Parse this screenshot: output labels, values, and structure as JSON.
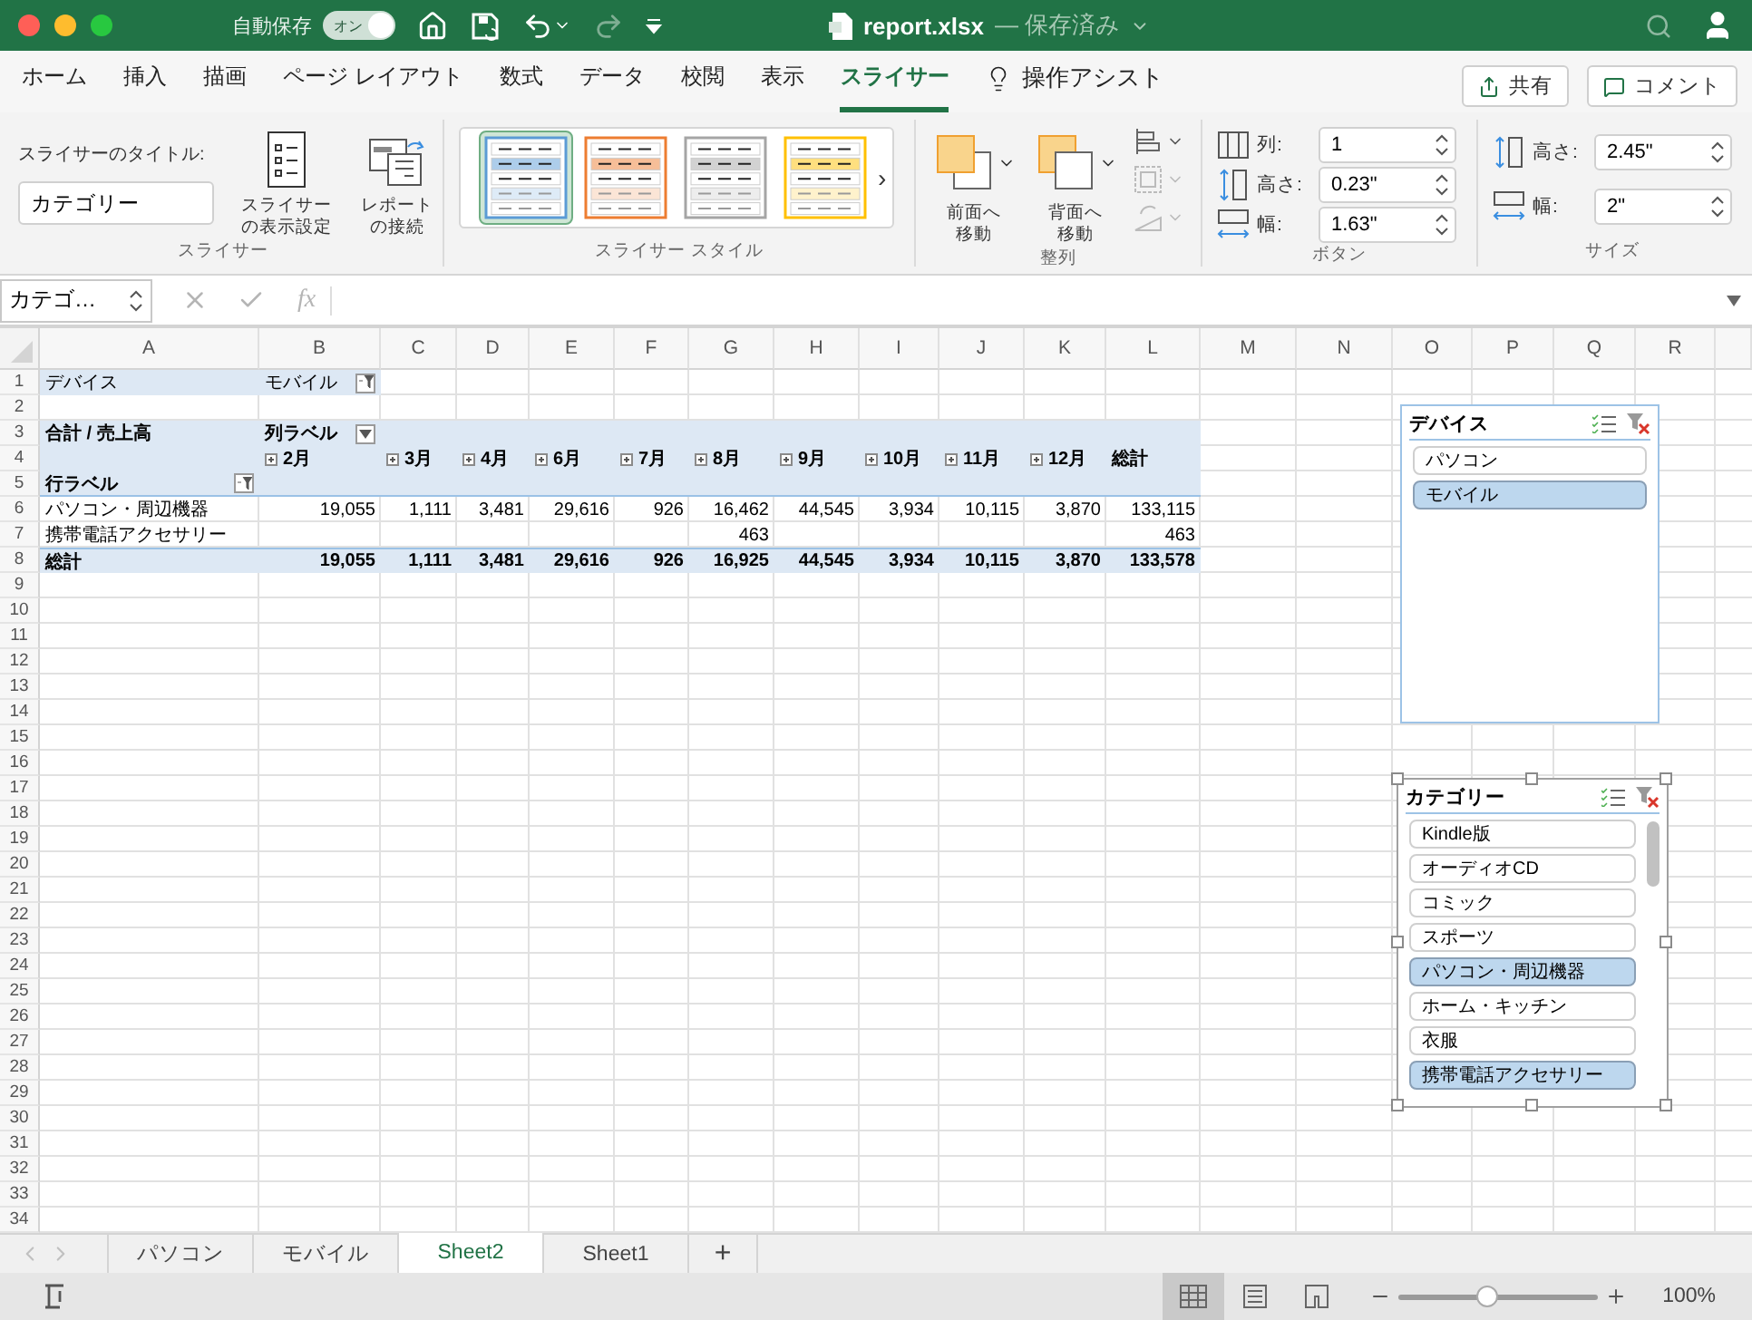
{
  "title_bar": {
    "autosave_label": "自動保存",
    "autosave": {
      "label": "オン",
      "on": true
    },
    "redo_disabled": true,
    "filename": "report.xlsx",
    "status": "— 保存済み"
  },
  "ribbon_tabs": [
    {
      "label": "ホーム",
      "selected": false
    },
    {
      "label": "挿入",
      "selected": false
    },
    {
      "label": "描画",
      "selected": false
    },
    {
      "label": "ページ レイアウト",
      "selected": false
    },
    {
      "label": "数式",
      "selected": false
    },
    {
      "label": "データ",
      "selected": false
    },
    {
      "label": "校閲",
      "selected": false
    },
    {
      "label": "表示",
      "selected": false
    },
    {
      "label": "スライサー",
      "selected": true
    }
  ],
  "tell_me": "操作アシスト",
  "share_button": "共有",
  "comment_button": "コメント",
  "ribbon": {
    "slicer_group": {
      "title_label": "スライサーのタイトル:",
      "title_value": "カテゴリー",
      "buttons": [
        {
          "kind": "settings",
          "lines": [
            "スライサー",
            "の表示設定"
          ]
        },
        {
          "kind": "connections",
          "lines": [
            "レポート",
            "の接続"
          ]
        }
      ],
      "label": "スライサー"
    },
    "styles_group": {
      "styles": [
        {
          "color": "#5b9bd5",
          "selected": true
        },
        {
          "color": "#ed7d31",
          "selected": false
        },
        {
          "color": "#a5a5a5",
          "selected": false
        },
        {
          "color": "#ffc000",
          "selected": false
        }
      ],
      "more": "›",
      "label": "スライサー スタイル"
    },
    "arrange_group": {
      "buttons": [
        {
          "kind": "front",
          "lines": [
            "前面へ",
            "移動"
          ]
        },
        {
          "kind": "back",
          "lines": [
            "背面へ",
            "移動"
          ]
        }
      ],
      "small_buttons": [
        {
          "kind": "align",
          "disabled": false
        },
        {
          "kind": "group",
          "disabled": true
        },
        {
          "kind": "rotate",
          "disabled": true
        }
      ],
      "label": "整列"
    },
    "buttons_group": {
      "fields": [
        {
          "kind": "columns",
          "label": "列:",
          "value": "1"
        },
        {
          "kind": "height",
          "label": "高さ:",
          "value": "0.23\""
        },
        {
          "kind": "width",
          "label": "幅:",
          "value": "1.63\""
        }
      ],
      "label": "ボタン"
    },
    "size_group": {
      "fields": [
        {
          "kind": "height",
          "label": "高さ:",
          "value": "2.45\""
        },
        {
          "kind": "width",
          "label": "幅:",
          "value": "2\""
        }
      ],
      "label": "サイズ"
    }
  },
  "formula_bar": {
    "name_box": "カテゴ…",
    "fx": "fx"
  },
  "sheet": {
    "columns": [
      "A",
      "B",
      "C",
      "D",
      "E",
      "F",
      "G",
      "H",
      "I",
      "J",
      "K",
      "L",
      "M",
      "N",
      "O",
      "P",
      "Q",
      "R"
    ],
    "rows": [
      {
        "number": "1",
        "kind": "filter",
        "cells": {
          "A": {
            "text": "デバイス"
          },
          "B": {
            "text": "モバイル",
            "dropdown": {
              "filtered": true
            }
          }
        }
      },
      {
        "number": "2"
      },
      {
        "number": "3",
        "kind": "header",
        "cells": {
          "A": {
            "text": "合計 / 売上高"
          },
          "B": {
            "text": "列ラベル",
            "dropdown": {
              "filtered": false
            }
          }
        }
      },
      {
        "number": "4",
        "kind": "header",
        "cells": {
          "B": {
            "text": "2月",
            "expandable": true
          },
          "C": {
            "text": "3月",
            "expandable": true
          },
          "D": {
            "text": "4月",
            "expandable": true
          },
          "E": {
            "text": "6月",
            "expandable": true
          },
          "F": {
            "text": "7月",
            "expandable": true
          },
          "G": {
            "text": "8月",
            "expandable": true
          },
          "H": {
            "text": "9月",
            "expandable": true
          },
          "I": {
            "text": "10月",
            "expandable": true
          },
          "J": {
            "text": "11月",
            "expandable": true
          },
          "K": {
            "text": "12月",
            "expandable": true
          },
          "L": {
            "text": "総計"
          }
        }
      },
      {
        "number": "5",
        "kind": "header_last",
        "cells": {
          "A": {
            "text": "行ラベル",
            "dropdown": {
              "filtered": true
            }
          }
        }
      },
      {
        "number": "6",
        "kind": "data",
        "cells": {
          "A": {
            "text": "パソコン・周辺機器"
          },
          "B": {
            "text": "19,055"
          },
          "C": {
            "text": "1,111"
          },
          "D": {
            "text": "3,481"
          },
          "E": {
            "text": "29,616"
          },
          "F": {
            "text": "926"
          },
          "G": {
            "text": "16,462"
          },
          "H": {
            "text": "44,545"
          },
          "I": {
            "text": "3,934"
          },
          "J": {
            "text": "10,115"
          },
          "K": {
            "text": "3,870"
          },
          "L": {
            "text": "133,115"
          }
        }
      },
      {
        "number": "7",
        "kind": "data",
        "cells": {
          "A": {
            "text": "携帯電話アクセサリー"
          },
          "G": {
            "text": "463"
          },
          "L": {
            "text": "463"
          }
        }
      },
      {
        "number": "8",
        "kind": "total",
        "cells": {
          "A": {
            "text": "総計"
          },
          "B": {
            "text": "19,055"
          },
          "C": {
            "text": "1,111"
          },
          "D": {
            "text": "3,481"
          },
          "E": {
            "text": "29,616"
          },
          "F": {
            "text": "926"
          },
          "G": {
            "text": "16,925"
          },
          "H": {
            "text": "44,545"
          },
          "I": {
            "text": "3,934"
          },
          "J": {
            "text": "10,115"
          },
          "K": {
            "text": "3,870"
          },
          "L": {
            "text": "133,578"
          }
        }
      },
      {
        "number": "9"
      },
      {
        "number": "10"
      },
      {
        "number": "11"
      },
      {
        "number": "12"
      },
      {
        "number": "13"
      },
      {
        "number": "14"
      },
      {
        "number": "15"
      },
      {
        "number": "16"
      },
      {
        "number": "17"
      },
      {
        "number": "18"
      },
      {
        "number": "19"
      },
      {
        "number": "20"
      },
      {
        "number": "21"
      },
      {
        "number": "22"
      },
      {
        "number": "23"
      },
      {
        "number": "24"
      },
      {
        "number": "25"
      },
      {
        "number": "26"
      },
      {
        "number": "27"
      },
      {
        "number": "28"
      },
      {
        "number": "29"
      },
      {
        "number": "30"
      },
      {
        "number": "31"
      },
      {
        "number": "32"
      },
      {
        "number": "33"
      },
      {
        "number": "34"
      }
    ]
  },
  "slicers": [
    {
      "title": "デバイス",
      "frame_selected": false,
      "scrollable": false,
      "items": [
        {
          "label": "パソコン",
          "selected": false
        },
        {
          "label": "モバイル",
          "selected": true
        }
      ]
    },
    {
      "title": "カテゴリー",
      "frame_selected": true,
      "scrollable": true,
      "items": [
        {
          "label": "Kindle版",
          "selected": false
        },
        {
          "label": "オーディオCD",
          "selected": false
        },
        {
          "label": "コミック",
          "selected": false
        },
        {
          "label": "スポーツ",
          "selected": false
        },
        {
          "label": "パソコン・周辺機器",
          "selected": true
        },
        {
          "label": "ホーム・キッチン",
          "selected": false
        },
        {
          "label": "衣服",
          "selected": false
        },
        {
          "label": "携帯電話アクセサリー",
          "selected": true
        }
      ]
    }
  ],
  "sheet_tabs": [
    {
      "label": "パソコン",
      "selected": false
    },
    {
      "label": "モバイル",
      "selected": false
    },
    {
      "label": "Sheet2",
      "selected": true
    },
    {
      "label": "Sheet1",
      "selected": false
    }
  ],
  "add_sheet": "+",
  "status_bar": {
    "views": [
      {
        "kind": "normal",
        "selected": true
      },
      {
        "kind": "page_layout",
        "selected": false
      },
      {
        "kind": "page_break",
        "selected": false
      }
    ],
    "zoom": {
      "level": 0.45,
      "reading": "100%"
    }
  }
}
